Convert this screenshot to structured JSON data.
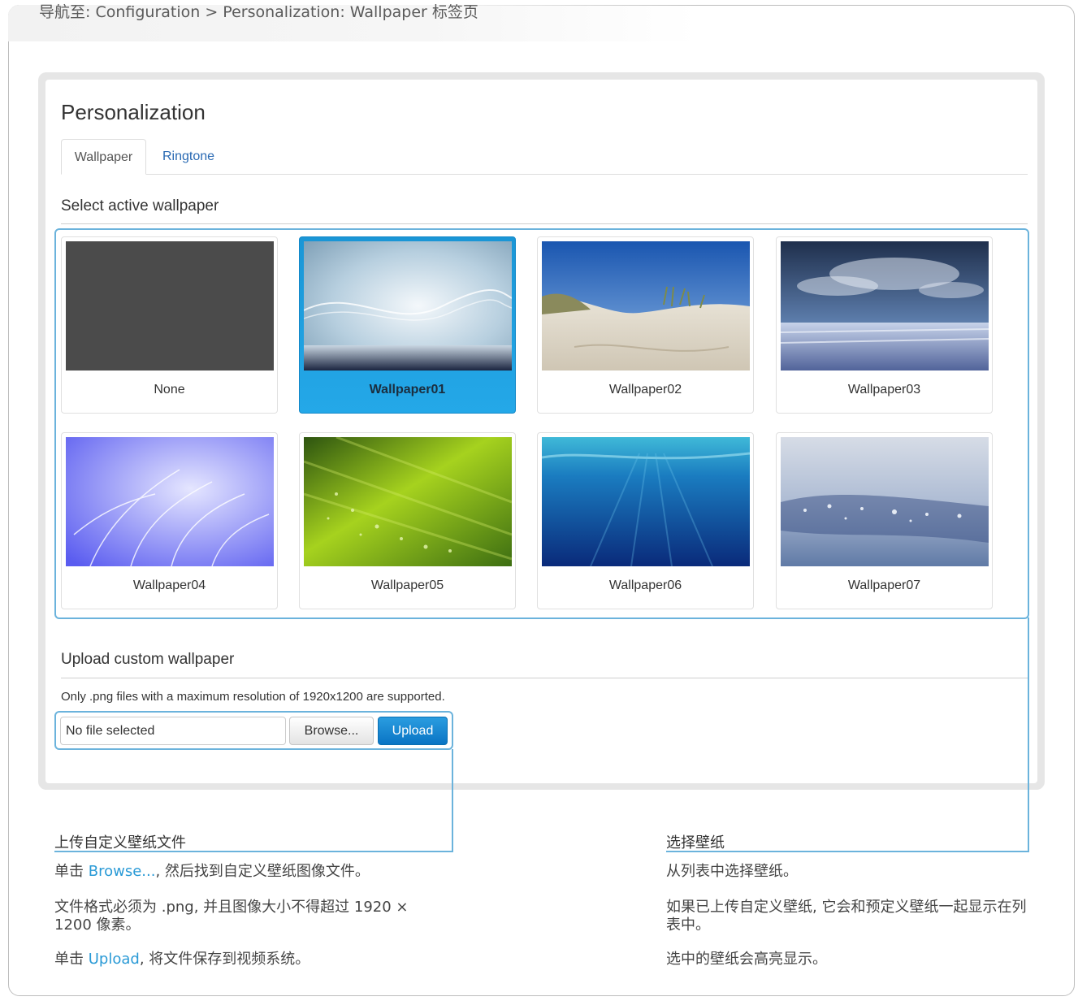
{
  "nav_hint": "导航至: Configuration > Personalization: Wallpaper 标签页",
  "page_title": "Personalization",
  "tabs": [
    {
      "label": "Wallpaper",
      "active": true
    },
    {
      "label": "Ringtone",
      "active": false
    }
  ],
  "select_section": {
    "title": "Select active wallpaper",
    "selected": "Wallpaper01",
    "items": [
      {
        "label": "None"
      },
      {
        "label": "Wallpaper01"
      },
      {
        "label": "Wallpaper02"
      },
      {
        "label": "Wallpaper03"
      },
      {
        "label": "Wallpaper04"
      },
      {
        "label": "Wallpaper05"
      },
      {
        "label": "Wallpaper06"
      },
      {
        "label": "Wallpaper07"
      }
    ]
  },
  "upload_section": {
    "title": "Upload custom wallpaper",
    "note": "Only .png files with a maximum resolution of 1920x1200 are supported.",
    "file_value": "No file selected",
    "browse_label": "Browse...",
    "upload_label": "Upload"
  },
  "annotations": {
    "upload": {
      "heading": "上传自定义壁纸文件",
      "p1_pre": "单击 ",
      "p1_link": "Browse...",
      "p1_post": ", 然后找到自定义壁纸图像文件。",
      "p2": "文件格式必须为 .png, 并且图像大小不得超过 1920 × 1200 像素。",
      "p3_pre": "单击 ",
      "p3_link": "Upload",
      "p3_post": ", 将文件保存到视频系统。"
    },
    "select": {
      "heading": "选择壁纸",
      "p1": "从列表中选择壁纸。",
      "p2": "如果已上传自定义壁纸, 它会和预定义壁纸一起显示在列表中。",
      "p3": "选中的壁纸会高亮显示。"
    }
  },
  "colors": {
    "accent": "#1a96d6",
    "callout": "#6bb3dc",
    "link": "#2a9ad6",
    "tab_link": "#2a6ab3"
  }
}
